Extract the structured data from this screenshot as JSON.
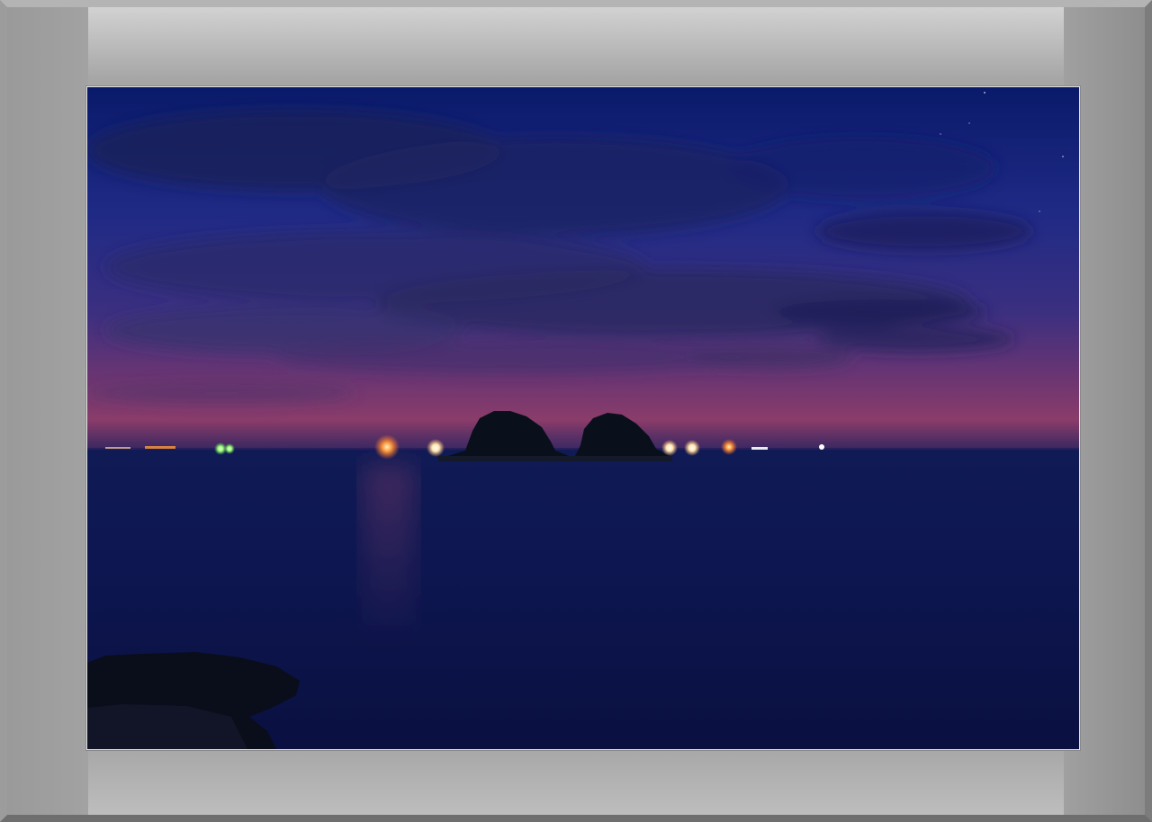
{
  "scene": {
    "subject": "night-seascape",
    "colors": {
      "sky_top": "#0d1f6e",
      "sky_mid": "#2a2a78",
      "horizon_glow": "#8a3d6e",
      "sea": "#0b1446",
      "island": "#0a0f1c",
      "light_warm": "#ff9a3c",
      "light_white": "#ffffff",
      "light_green": "#9dff7a",
      "frame": "#a4a4a4"
    }
  }
}
